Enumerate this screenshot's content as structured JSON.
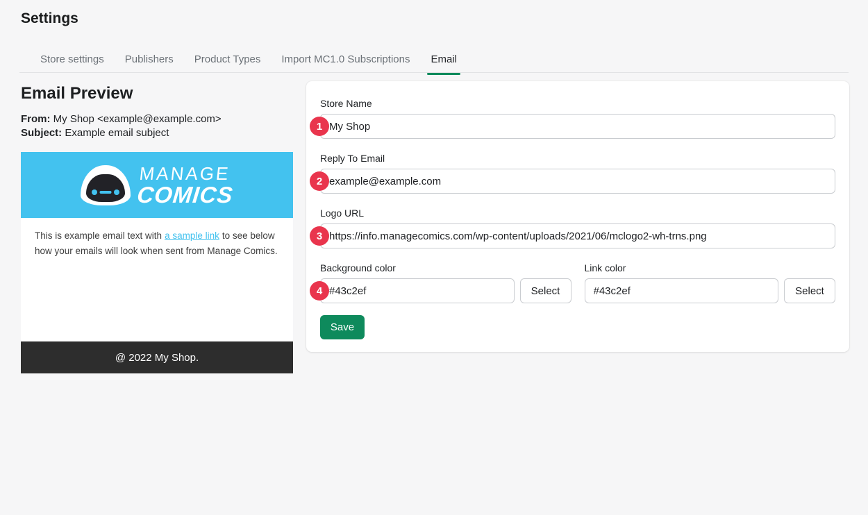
{
  "page": {
    "title": "Settings"
  },
  "tabs": [
    {
      "label": "Store settings"
    },
    {
      "label": "Publishers"
    },
    {
      "label": "Product Types"
    },
    {
      "label": "Import MC1.0 Subscriptions"
    },
    {
      "label": "Email"
    }
  ],
  "preview": {
    "title": "Email Preview",
    "from_label": "From:",
    "from_value": "My Shop <example@example.com>",
    "subject_label": "Subject:",
    "subject_value": "Example email subject",
    "logo": {
      "icon": "robot-face-icon",
      "line1": "MANAGE",
      "line2": "COMICS"
    },
    "body_text_before": "This is example email text with",
    "body_link_text": "a sample link",
    "body_text_after": "to see below how your emails will look when sent from Manage Comics.",
    "footer_text": "@ 2022 My Shop."
  },
  "form": {
    "fields": [
      {
        "badge": "1",
        "label": "Store Name",
        "value": "My Shop"
      },
      {
        "badge": "2",
        "label": "Reply To Email",
        "value": "example@example.com"
      },
      {
        "badge": "3",
        "label": "Logo URL",
        "value": "https://info.managecomics.com/wp-content/uploads/2021/06/mclogo2-wh-trns.png"
      }
    ],
    "background_color": {
      "badge": "4",
      "label": "Background color",
      "value": "#43c2ef",
      "button_label": "Select"
    },
    "link_color": {
      "label": "Link color",
      "value": "#43c2ef",
      "button_label": "Select"
    },
    "save_label": "Save"
  },
  "colors": {
    "accent_blue": "#43c2ef",
    "active_green": "#0e8a5c",
    "badge_red": "#e9354d",
    "footer_dark": "#2d2d2d",
    "page_background": "#f6f6f7"
  }
}
